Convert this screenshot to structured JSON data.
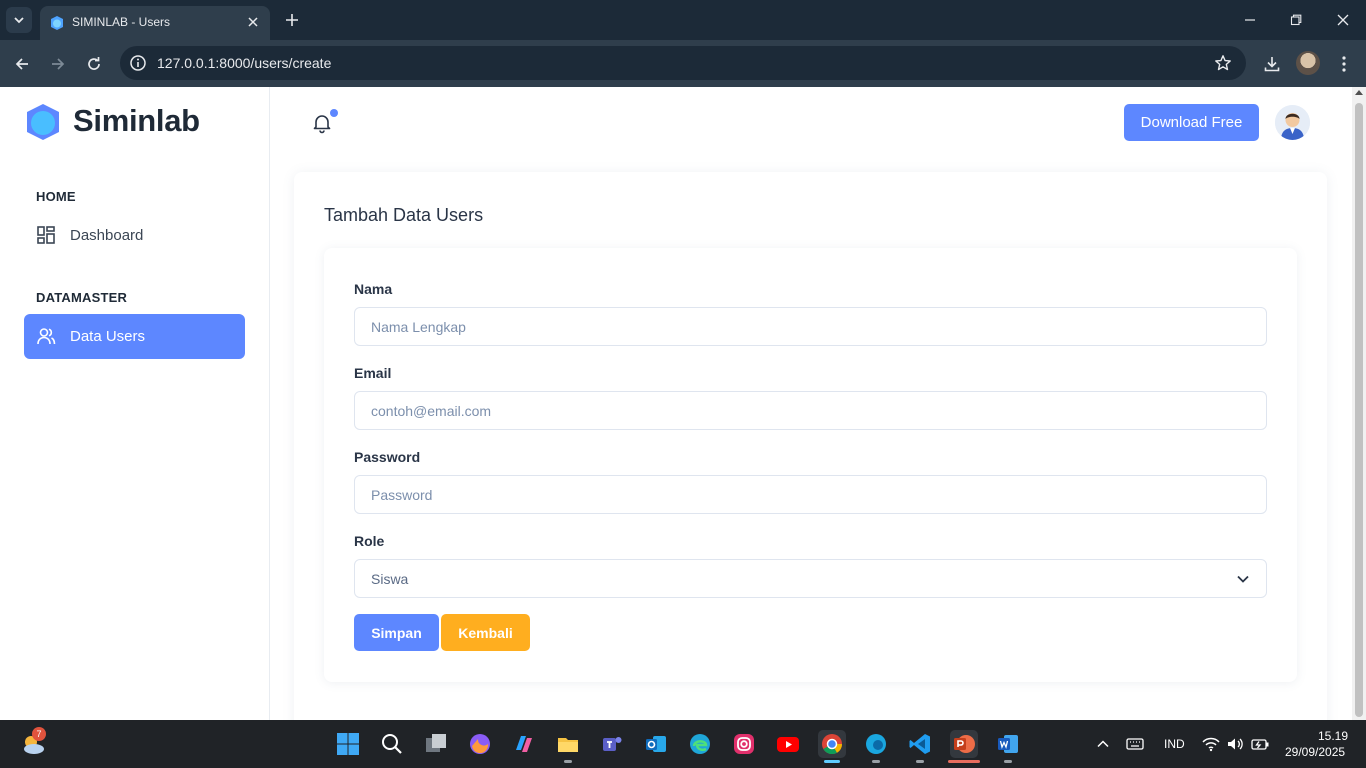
{
  "browser": {
    "tab_title": "SIMINLAB - Users",
    "url_host": "127.0.0.1",
    "url_path": ":8000/users/create"
  },
  "sidebar": {
    "brand": "Siminlab",
    "sections": [
      {
        "caption": "HOME",
        "items": [
          {
            "label": "Dashboard",
            "icon": "dashboard-icon",
            "active": false
          }
        ]
      },
      {
        "caption": "DATAMASTER",
        "items": [
          {
            "label": "Data Users",
            "icon": "users-icon",
            "active": true
          }
        ]
      }
    ]
  },
  "header": {
    "download_label": "Download Free"
  },
  "form": {
    "title": "Tambah Data Users",
    "name_label": "Nama",
    "name_placeholder": "Nama Lengkap",
    "email_label": "Email",
    "email_placeholder": "contoh@email.com",
    "password_label": "Password",
    "password_placeholder": "Password",
    "role_label": "Role",
    "role_value": "Siswa",
    "save_label": "Simpan",
    "back_label": "Kembali"
  },
  "colors": {
    "primary": "#5d87ff",
    "warning": "#ffae1f",
    "browser_dark": "#1c2a38"
  },
  "taskbar": {
    "weather_badge": "7",
    "language": "IND",
    "time": "15.19",
    "date": "29/09/2025",
    "apps": [
      "start-icon",
      "search-icon",
      "task-view-icon",
      "firefox-icon",
      "copilot-icon",
      "file-explorer-icon",
      "teams-icon",
      "outlook-icon",
      "edge-icon",
      "instagram-icon",
      "youtube-icon",
      "chrome-icon",
      "edge-beta-icon",
      "vscode-icon",
      "powerpoint-icon",
      "word-icon"
    ]
  }
}
